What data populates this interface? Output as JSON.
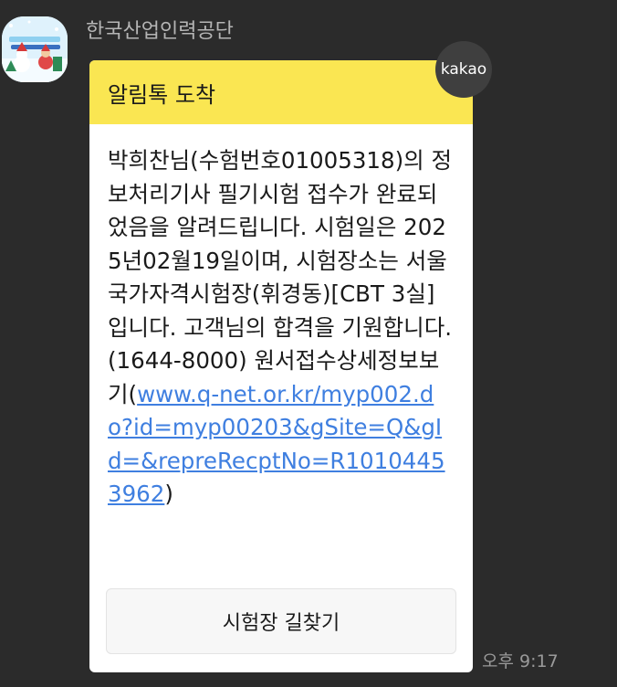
{
  "chat": {
    "sender_name": "한국산업인력공단",
    "avatar_icon": "hrdk-christmas-profile-icon",
    "badge_label": "kakao",
    "time": "오후 9:17"
  },
  "message": {
    "header": "알림톡 도착",
    "body_text": "박희찬님(수험번호01005318)의 정보처리기사 필기시험 접수가 완료되었음을 알려드립니다. 시험일은 2025년02월19일이며, 시험장소는 서울국가자격시험장(휘경동)[CBT 3실]입니다. 고객님의 합격을 기원합니다. (1644-8000) 원서접수상세정보보기(",
    "link": "www.q-net.or.kr/myp002.do?id=myp00203&gSite=Q&gId=&repreRecptNo=R10104453962",
    "body_suffix": ")",
    "button_label": "시험장 길찾기"
  },
  "colors": {
    "background": "#2b2b2b",
    "header_yellow": "#fae652",
    "link_blue": "#3f7fe0"
  }
}
